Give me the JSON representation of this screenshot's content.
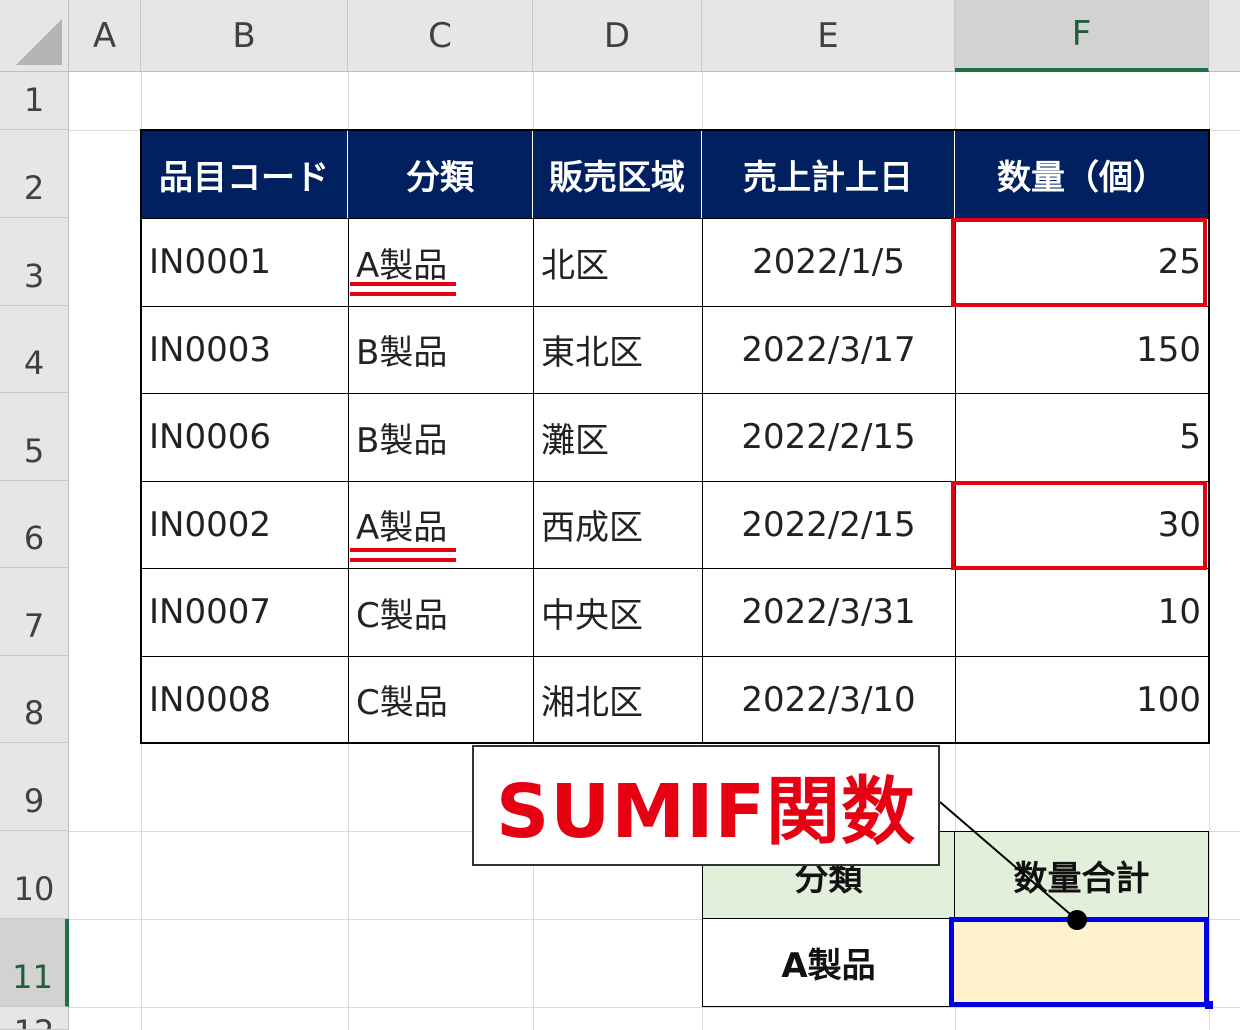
{
  "columns": [
    "A",
    "B",
    "C",
    "D",
    "E",
    "F"
  ],
  "rows": [
    "1",
    "2",
    "3",
    "4",
    "5",
    "6",
    "7",
    "8",
    "9",
    "10",
    "11",
    "12"
  ],
  "selected_column": "F",
  "selected_row": "11",
  "table": {
    "headers": [
      "品目コード",
      "分類",
      "販売区域",
      "売上計上日",
      "数量（個）"
    ],
    "rows": [
      {
        "code": "IN0001",
        "category": "A製品",
        "area": "北区",
        "date": "2022/1/5",
        "qty": "25"
      },
      {
        "code": "IN0003",
        "category": "B製品",
        "area": "東北区",
        "date": "2022/3/17",
        "qty": "150"
      },
      {
        "code": "IN0006",
        "category": "B製品",
        "area": "灘区",
        "date": "2022/2/15",
        "qty": "5"
      },
      {
        "code": "IN0002",
        "category": "A製品",
        "area": "西成区",
        "date": "2022/2/15",
        "qty": "30"
      },
      {
        "code": "IN0007",
        "category": "C製品",
        "area": "中央区",
        "date": "2022/3/31",
        "qty": "10"
      },
      {
        "code": "IN0008",
        "category": "C製品",
        "area": "湘北区",
        "date": "2022/3/10",
        "qty": "100"
      }
    ]
  },
  "summary": {
    "header_category": "分類",
    "header_total": "数量合計",
    "category_value": "A製品",
    "total_value": ""
  },
  "callout": {
    "text": "SUMIF関数"
  },
  "colors": {
    "table_header_bg": "#002060",
    "highlight_red": "#e60012",
    "summary_header_bg": "#e2efda",
    "result_bg": "#fff2cc",
    "selection_border": "#0000e6"
  }
}
